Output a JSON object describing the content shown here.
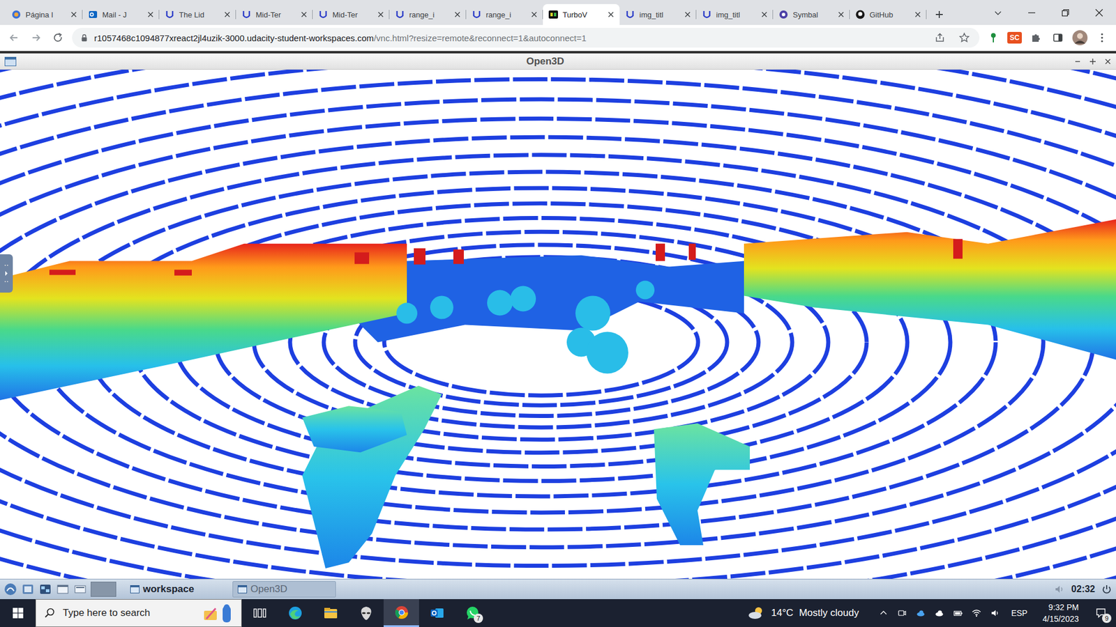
{
  "browser": {
    "tabs": [
      {
        "label": "Página I",
        "kind": "page",
        "selected": false
      },
      {
        "label": "Mail - J",
        "kind": "outlook",
        "selected": false
      },
      {
        "label": "The Lid",
        "kind": "udacity",
        "selected": false
      },
      {
        "label": "Mid-Ter",
        "kind": "udacity",
        "selected": false
      },
      {
        "label": "Mid-Ter",
        "kind": "udacity",
        "selected": false
      },
      {
        "label": "range_i",
        "kind": "udacity",
        "selected": false
      },
      {
        "label": "range_i",
        "kind": "udacity",
        "selected": false
      },
      {
        "label": "TurboV",
        "kind": "vnc",
        "selected": true
      },
      {
        "label": "img_titl",
        "kind": "udacity",
        "selected": false
      },
      {
        "label": "img_titl",
        "kind": "udacity",
        "selected": false
      },
      {
        "label": "Symbal",
        "kind": "symbolab",
        "selected": false
      },
      {
        "label": "GitHub",
        "kind": "github",
        "selected": false
      }
    ],
    "url": {
      "host": "r1057468c1094877xreact2jl4uzik-3000.udacity-student-workspaces.com",
      "path": "/vnc.html?resize=remote&reconnect=1&autoconnect=1"
    },
    "extension_badge": "SC"
  },
  "remote": {
    "window": {
      "title": "Open3D"
    },
    "taskbar": {
      "items": [
        {
          "label": "workspace",
          "selected": false
        },
        {
          "label": "Open3D",
          "selected": true
        }
      ],
      "clock": "02:32"
    }
  },
  "taskbar": {
    "search": {
      "placeholder": "Type here to search"
    },
    "apps": [
      {
        "kind": "taskview",
        "selected": false,
        "badge": ""
      },
      {
        "kind": "edge",
        "selected": false,
        "badge": ""
      },
      {
        "kind": "explorer",
        "selected": false,
        "badge": ""
      },
      {
        "kind": "alienware",
        "selected": false,
        "badge": ""
      },
      {
        "kind": "chrome",
        "selected": true,
        "badge": ""
      },
      {
        "kind": "outlook",
        "selected": false,
        "badge": ""
      },
      {
        "kind": "whatsapp",
        "selected": false,
        "badge": "7"
      }
    ],
    "weather": {
      "temp": "14°C",
      "condition": "Mostly cloudy"
    },
    "language": "ESP",
    "time": "9:32 PM",
    "date": "4/15/2023",
    "notifications": "9"
  }
}
